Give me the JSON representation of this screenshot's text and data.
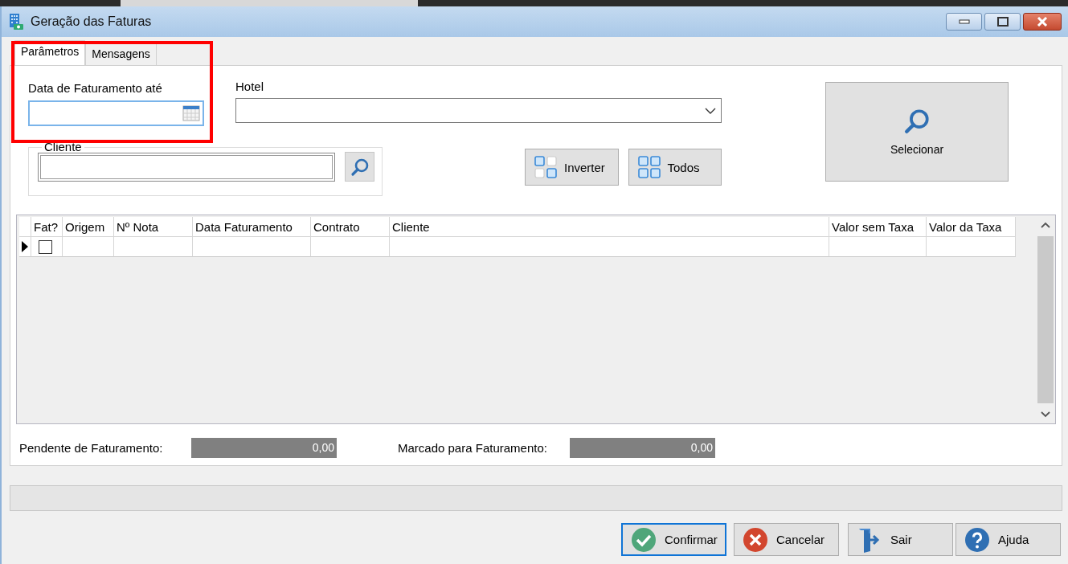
{
  "window": {
    "title": "Geração das Faturas"
  },
  "tabs": [
    {
      "label": "Parâmetros",
      "selected": true
    },
    {
      "label": "Mensagens",
      "selected": false
    }
  ],
  "date_field": {
    "label": "Data de Faturamento até",
    "focused": true
  },
  "hotel_field": {
    "label": "Hotel"
  },
  "client_group": {
    "legend": "Cliente"
  },
  "select_buttons": [
    {
      "label": "Inverter",
      "kind": "invert"
    },
    {
      "label": "Todos",
      "kind": "all"
    }
  ],
  "search_button": {
    "label": "Selecionar"
  },
  "table": {
    "columns": [
      "Fat?",
      "Origem",
      "Nº Nota",
      "Data Faturamento",
      "Contrato",
      "Cliente",
      "Valor sem Taxa",
      "Valor da Taxa"
    ],
    "rows": [
      {
        "current": true,
        "checked": false
      }
    ]
  },
  "totals": [
    {
      "label": "Pendente de Faturamento:",
      "value": "0,00"
    },
    {
      "label": "Marcado para Faturamento:",
      "value": "0,00"
    }
  ],
  "dialog_buttons": [
    {
      "label": "Confirmar",
      "kind": "confirm",
      "focused": true
    },
    {
      "label": "Cancelar",
      "kind": "cancel",
      "focused": false
    },
    {
      "label": "Sair",
      "kind": "exit",
      "focused": false
    },
    {
      "label": "Ajuda",
      "kind": "help",
      "focused": false
    }
  ],
  "annotations": [
    {
      "kind": "rectangle",
      "color": "#ff0000"
    }
  ]
}
